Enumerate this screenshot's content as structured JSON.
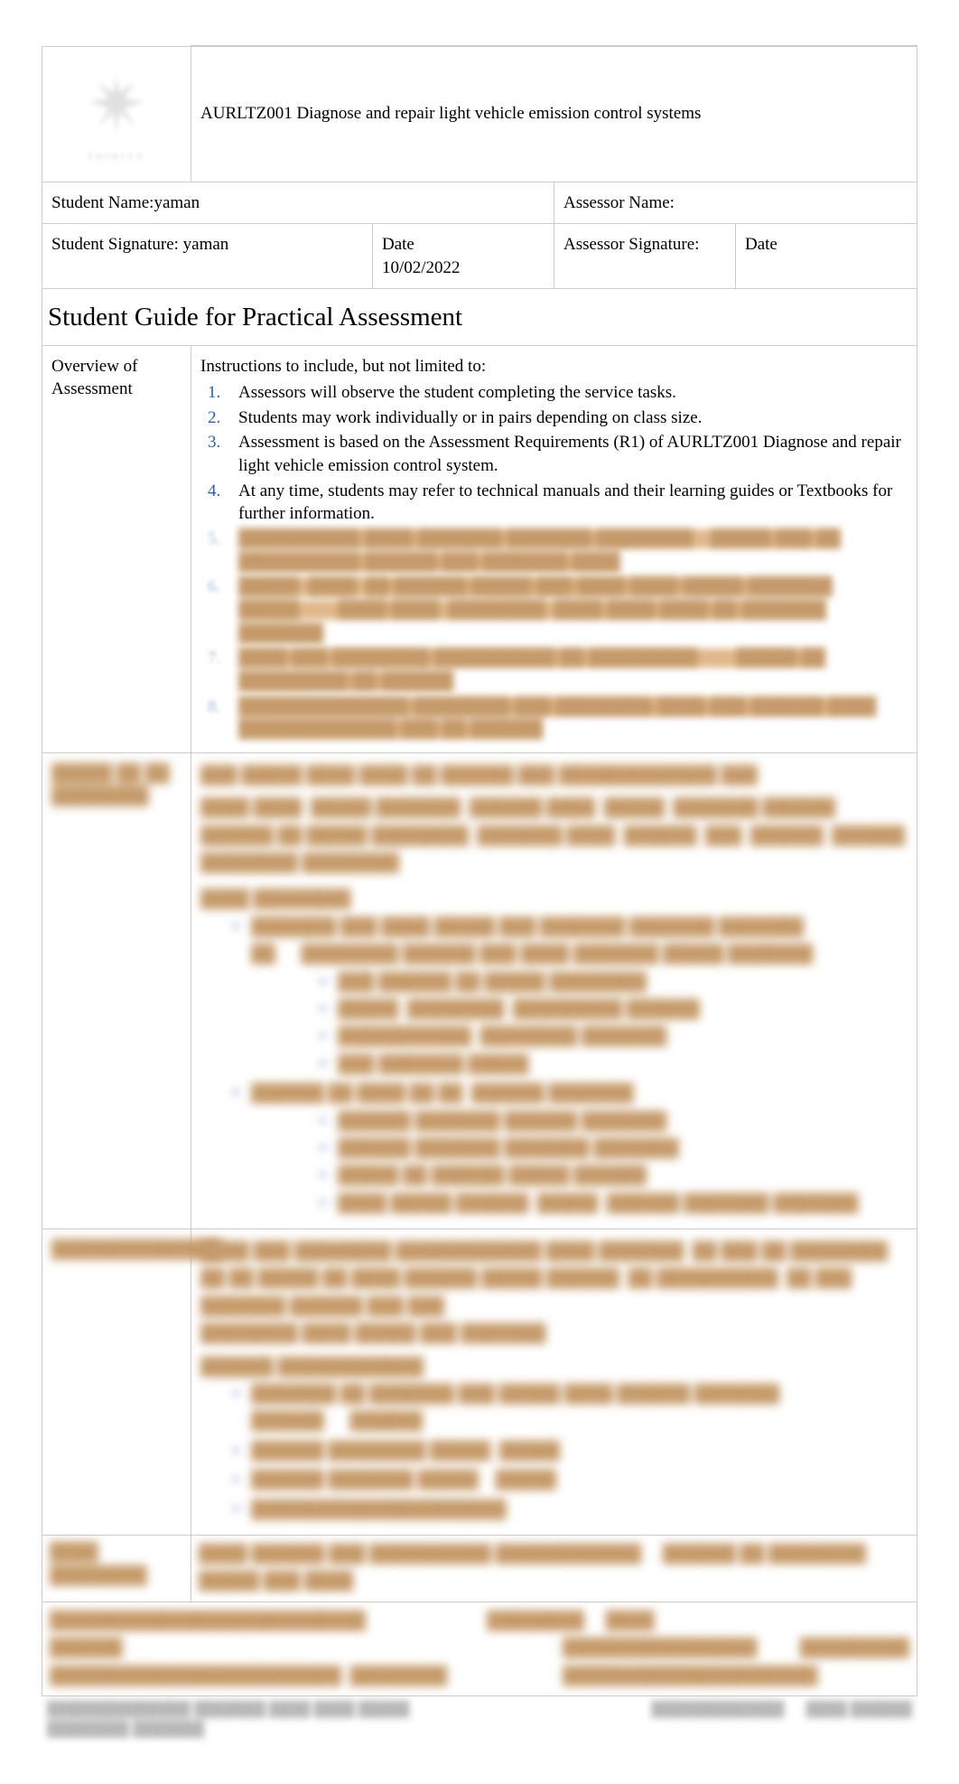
{
  "header": {
    "course_title": "AURLTZ001 Diagnose and repair light vehicle emission control systems"
  },
  "info": {
    "student_name_label": "Student Name:",
    "student_name_value": "yaman",
    "assessor_name_label": "Assessor Name:",
    "assessor_name_value": "",
    "student_sig_label": "Student Signature:",
    "student_sig_value": "yaman",
    "student_sig_date_label": "Date",
    "student_sig_date_value": "10/02/2022",
    "assessor_sig_label": "Assessor Signature:",
    "assessor_sig_value": "",
    "assessor_sig_date_label": "Date",
    "assessor_sig_date_value": ""
  },
  "heading": "Student Guide for Practical Assessment",
  "overview": {
    "label": "Overview of Assessment",
    "intro": "Instructions to include, but not limited to:",
    "items": {
      "i1": "Assessors will observe the student completing the service tasks.",
      "i2": "Students may work individually or in pairs depending on class size.",
      "i3": "Assessment is based on the Assessment Requirements (R1) of AURLTZ001 Diagnose and repair light vehicle emission control       system.",
      "i4": "At any time, students may refer to technical manuals and their learning guides or Textbooks for further information."
    }
  }
}
